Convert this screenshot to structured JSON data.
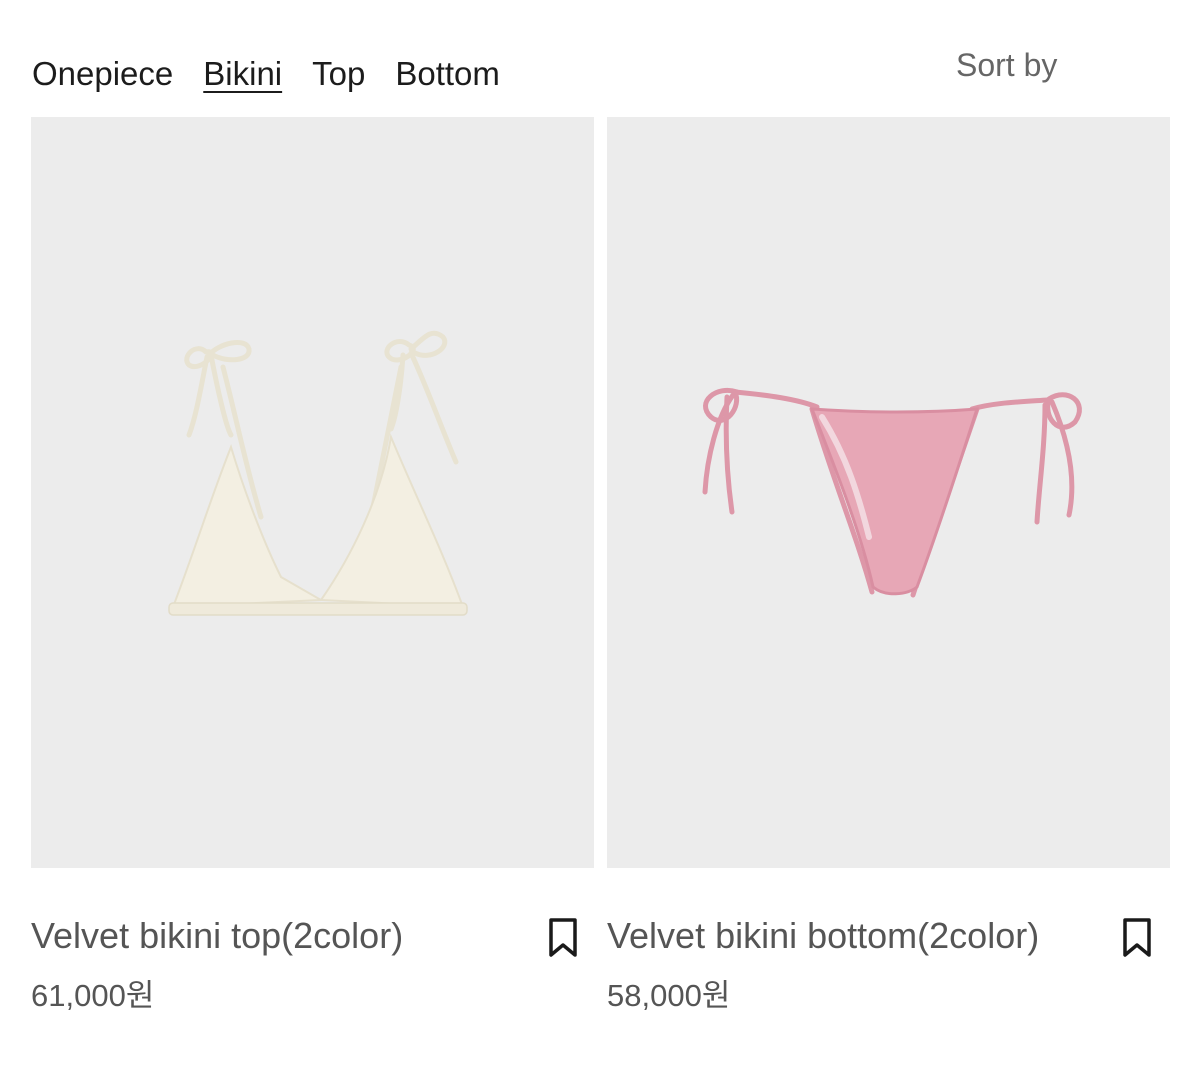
{
  "nav": {
    "tabs": [
      {
        "label": "Onepiece",
        "active": false
      },
      {
        "label": "Bikini",
        "active": true
      },
      {
        "label": "Top",
        "active": false
      },
      {
        "label": "Bottom",
        "active": false
      }
    ],
    "sort_label": "Sort by"
  },
  "products": [
    {
      "name": "Velvet bikini top(2color)",
      "price": "61,000원",
      "image": "ivory-triangle-bikini-top",
      "garment_color": "#f3efe2",
      "bookmark_icon": "bookmark-icon"
    },
    {
      "name": "Velvet bikini bottom(2color)",
      "price": "58,000원",
      "image": "pink-string-bikini-bottom",
      "garment_color": "#e7a7b6",
      "bookmark_icon": "bookmark-icon"
    }
  ],
  "colors": {
    "image_background": "#ececec",
    "text_dark": "#1c1c1c",
    "text_muted": "#555555"
  }
}
